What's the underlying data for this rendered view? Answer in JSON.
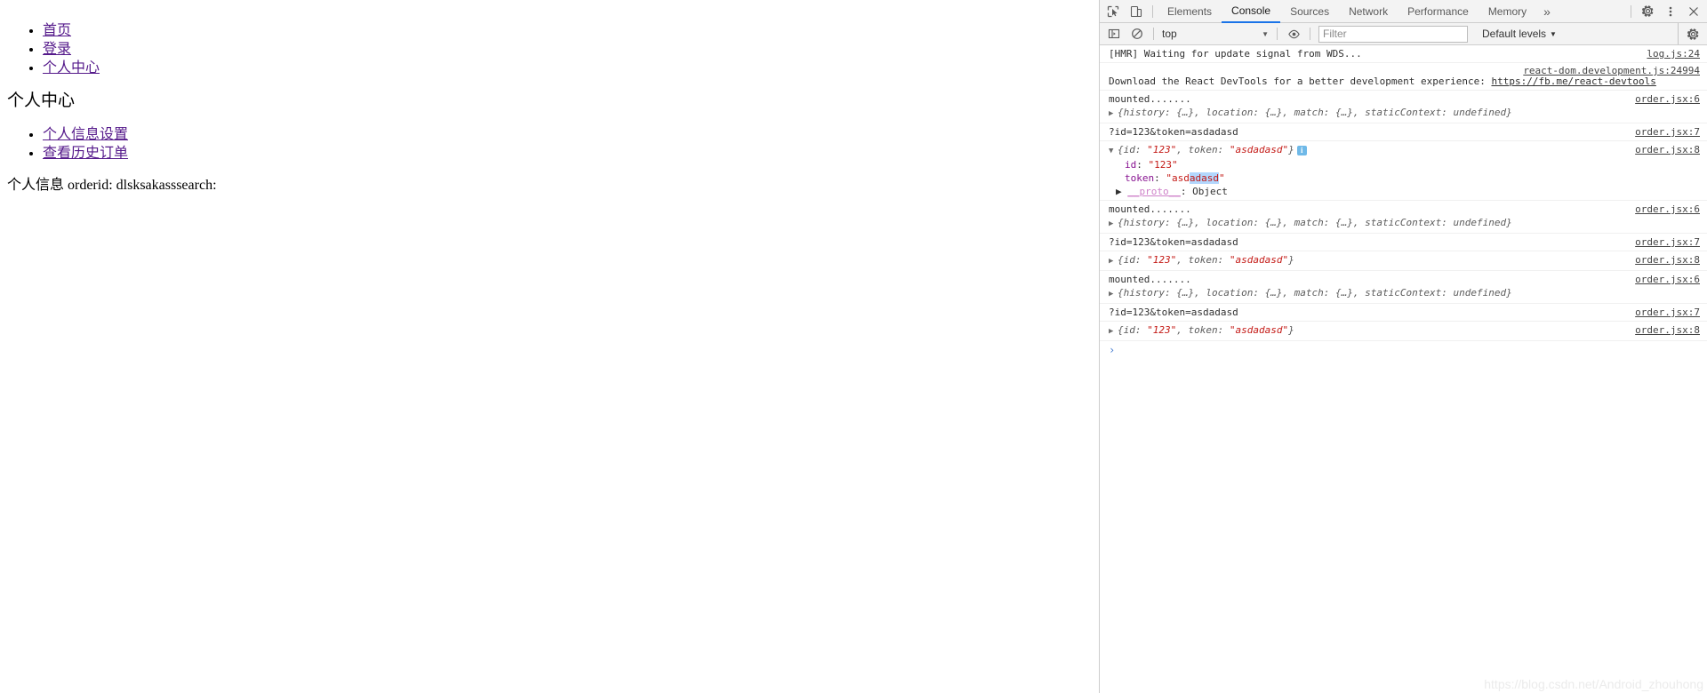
{
  "webpage": {
    "nav_links": [
      {
        "label": "首页"
      },
      {
        "label": "登录"
      },
      {
        "label": "个人中心"
      }
    ],
    "heading": "个人中心",
    "center_links": [
      {
        "label": "个人信息设置"
      },
      {
        "label": "查看历史订单"
      }
    ],
    "info_line": "个人信息 orderid: dlsksakasssearch:"
  },
  "devtools": {
    "toolbar": {
      "inspect_icon": "inspect-element-icon",
      "device_icon": "device-toolbar-icon",
      "tabs": [
        {
          "label": "Elements",
          "active": false
        },
        {
          "label": "Console",
          "active": true
        },
        {
          "label": "Sources",
          "active": false
        },
        {
          "label": "Network",
          "active": false
        },
        {
          "label": "Performance",
          "active": false
        },
        {
          "label": "Memory",
          "active": false
        }
      ],
      "more_tabs": "»",
      "settings_icon": "gear-icon",
      "menu_icon": "kebab-menu-icon",
      "close_icon": "close-icon"
    },
    "console_bar": {
      "sidebar_icon": "console-sidebar-icon",
      "clear_icon": "clear-console-icon",
      "context": "top",
      "caret": "▼",
      "eye_icon": "live-expression-icon",
      "filter_value": "",
      "filter_placeholder": "Filter",
      "levels_label": "Default levels",
      "settings_icon": "gear-icon"
    },
    "messages": [
      {
        "id": "hmr",
        "kind": "text",
        "text": "[HMR] Waiting for update signal from WDS...",
        "source": "log.js:24",
        "source_position": "inline"
      },
      {
        "id": "react-devtools",
        "kind": "text-with-link",
        "text_before": "Download the React DevTools for a better development experience: ",
        "link_text": "https://fb.me/react-devtools",
        "source": "react-dom.development.js:24994",
        "source_position": "above"
      },
      {
        "id": "mounted-1",
        "kind": "text-plus-object",
        "text": "mounted.......",
        "source": "order.jsx:6",
        "object_preview": "{history: {…}, location: {…}, match: {…}, staticContext: undefined}",
        "triangle": "▶"
      },
      {
        "id": "query-1",
        "kind": "text",
        "text": "?id=123&token=asdadasd",
        "source": "order.jsx:7",
        "source_position": "inline"
      },
      {
        "id": "obj-expanded",
        "kind": "object-expanded",
        "triangle": "▼",
        "preview_prefix": "{id: ",
        "preview_id": "\"123\"",
        "preview_mid": ", token: ",
        "preview_token": "\"asdadasd\"",
        "preview_suffix": "}",
        "info_badge": "i",
        "source": "order.jsx:8",
        "properties": [
          {
            "key": "id",
            "value": "\"123\"",
            "selected": ""
          },
          {
            "key": "token",
            "value_pre": "\"asd",
            "value_sel": "adasd",
            "value_post": "\""
          }
        ],
        "proto_triangle": "▶",
        "proto_key": "__proto__",
        "proto_value": ": Object"
      },
      {
        "id": "mounted-2",
        "kind": "text-plus-object",
        "text": "mounted.......",
        "source": "order.jsx:6",
        "object_preview": "{history: {…}, location: {…}, match: {…}, staticContext: undefined}",
        "triangle": "▶"
      },
      {
        "id": "query-2",
        "kind": "text",
        "text": "?id=123&token=asdadasd",
        "source": "order.jsx:7",
        "source_position": "inline"
      },
      {
        "id": "obj-collapsed-1",
        "kind": "object-collapsed",
        "triangle": "▶",
        "preview_prefix": "{id: ",
        "preview_id": "\"123\"",
        "preview_mid": ", token: ",
        "preview_token": "\"asdadasd\"",
        "preview_suffix": "}",
        "source": "order.jsx:8"
      },
      {
        "id": "mounted-3",
        "kind": "text-plus-object",
        "text": "mounted.......",
        "source": "order.jsx:6",
        "object_preview": "{history: {…}, location: {…}, match: {…}, staticContext: undefined}",
        "triangle": "▶"
      },
      {
        "id": "query-3",
        "kind": "text",
        "text": "?id=123&token=asdadasd",
        "source": "order.jsx:7",
        "source_position": "inline"
      },
      {
        "id": "obj-collapsed-2",
        "kind": "object-collapsed",
        "triangle": "▶",
        "preview_prefix": "{id: ",
        "preview_id": "\"123\"",
        "preview_mid": ", token: ",
        "preview_token": "\"asdadasd\"",
        "preview_suffix": "}",
        "source": "order.jsx:8"
      }
    ],
    "prompt": {
      "chevron": "›",
      "value": ""
    }
  },
  "watermark": "https://blog.csdn.net/Android_zhouhong",
  "colors": {
    "link": "#551a8b",
    "accent": "#1a73e8",
    "string": "#c41a16",
    "key": "#881391",
    "selection": "#b3d7fd",
    "panel_bg": "#f3f3f3"
  }
}
